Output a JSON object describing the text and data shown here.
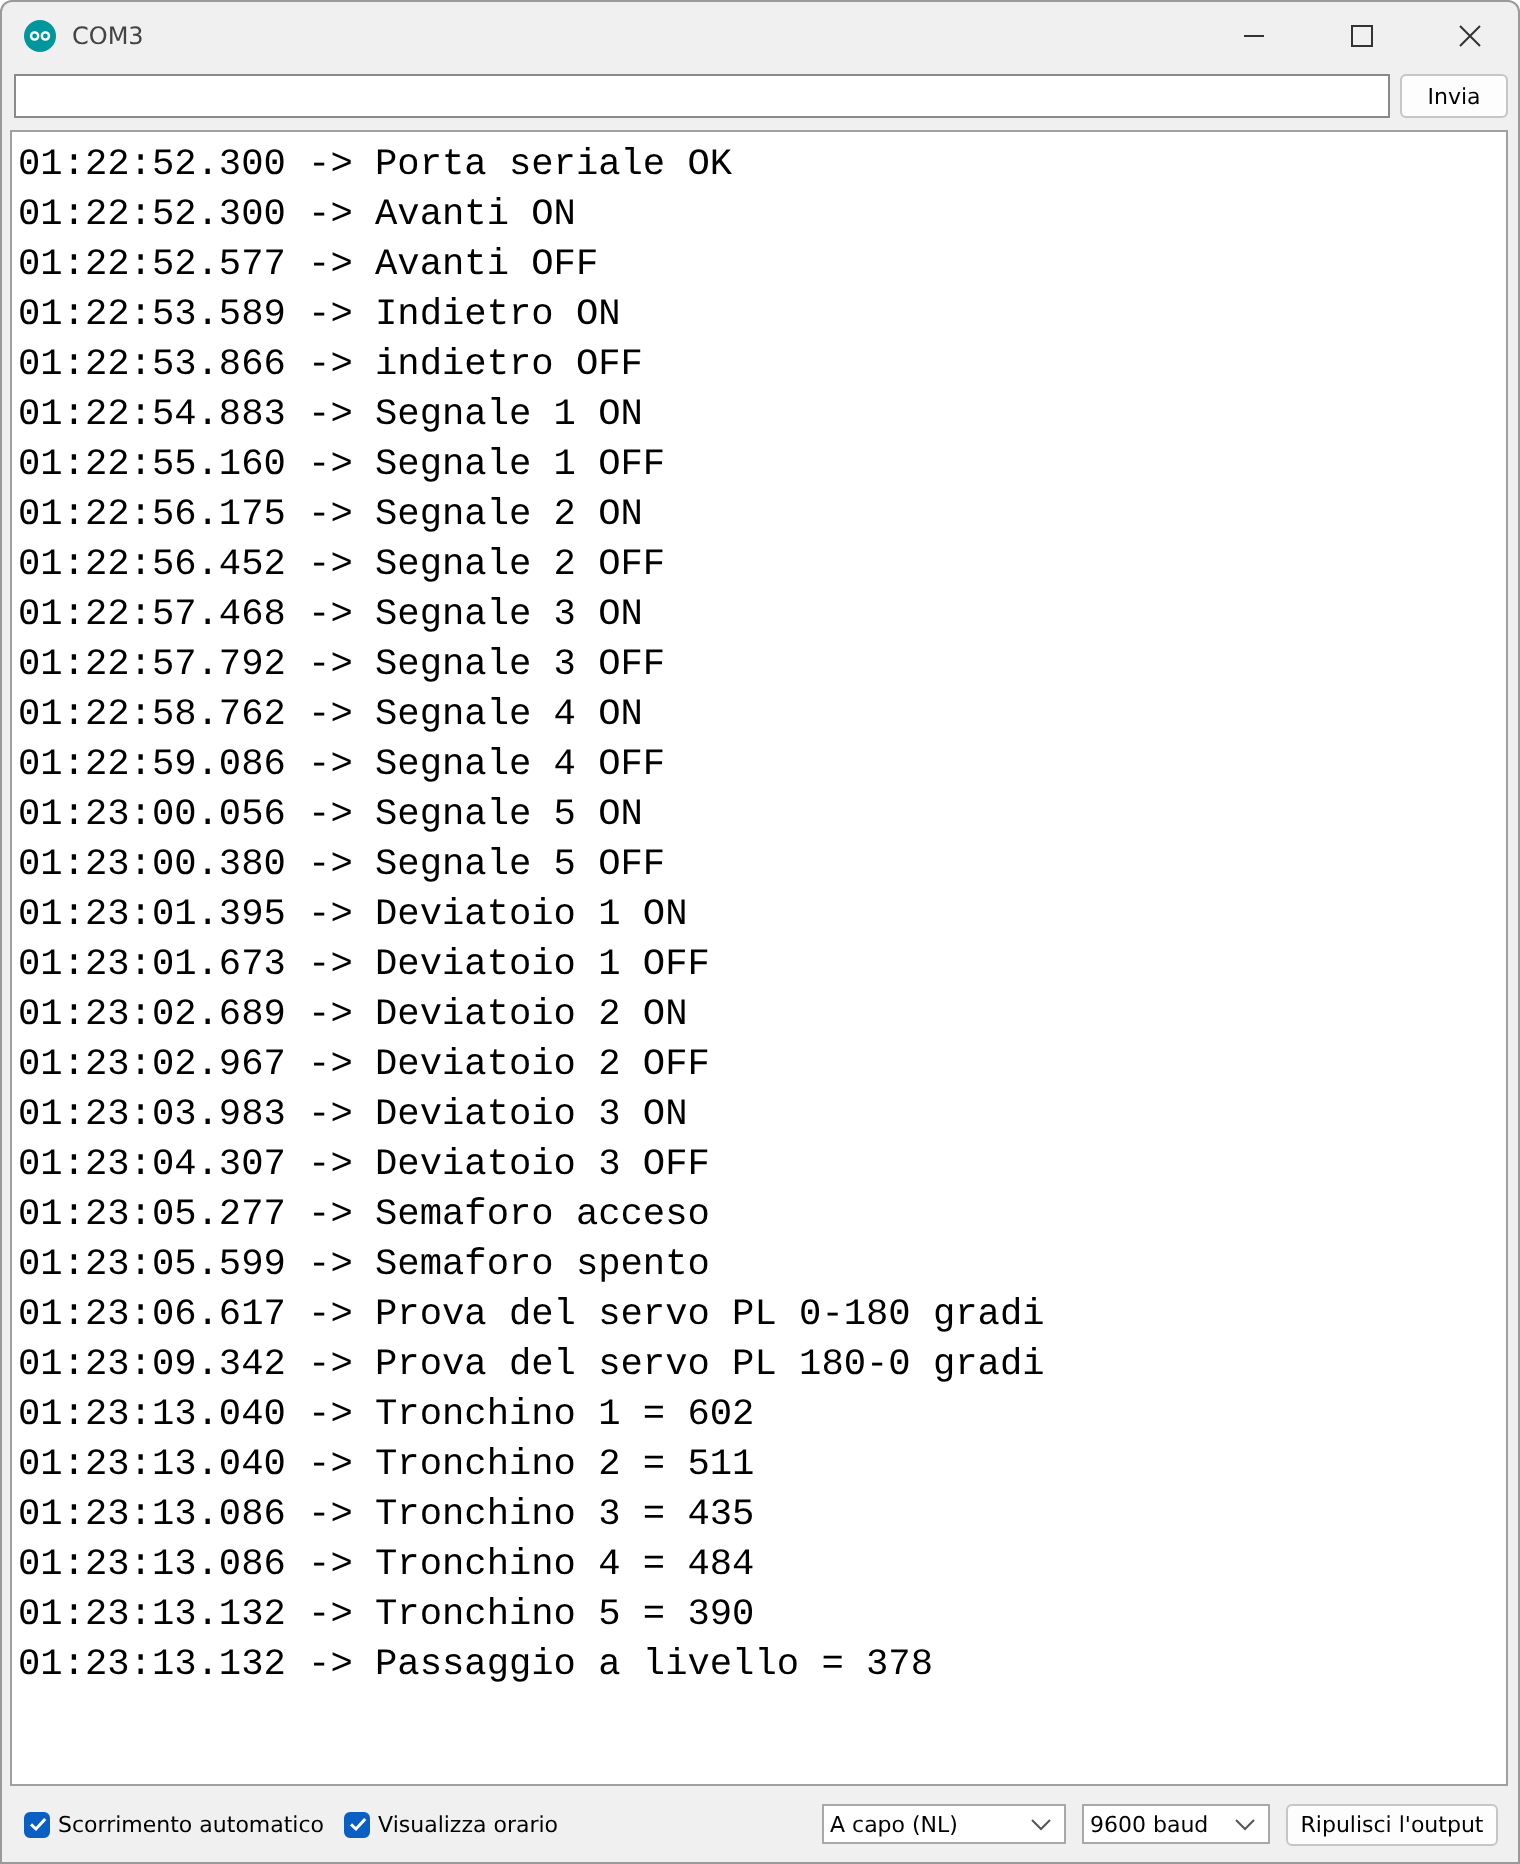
{
  "window": {
    "title": "COM3"
  },
  "send_button": "Invia",
  "log": [
    "01:22:52.300 -> Porta seriale OK",
    "01:22:52.300 -> Avanti ON",
    "01:22:52.577 -> Avanti OFF",
    "01:22:53.589 -> Indietro ON",
    "01:22:53.866 -> indietro OFF",
    "01:22:54.883 -> Segnale 1 ON",
    "01:22:55.160 -> Segnale 1 OFF",
    "01:22:56.175 -> Segnale 2 ON",
    "01:22:56.452 -> Segnale 2 OFF",
    "01:22:57.468 -> Segnale 3 ON",
    "01:22:57.792 -> Segnale 3 OFF",
    "01:22:58.762 -> Segnale 4 ON",
    "01:22:59.086 -> Segnale 4 OFF",
    "01:23:00.056 -> Segnale 5 ON",
    "01:23:00.380 -> Segnale 5 OFF",
    "01:23:01.395 -> Deviatoio 1 ON",
    "01:23:01.673 -> Deviatoio 1 OFF",
    "01:23:02.689 -> Deviatoio 2 ON",
    "01:23:02.967 -> Deviatoio 2 OFF",
    "01:23:03.983 -> Deviatoio 3 ON",
    "01:23:04.307 -> Deviatoio 3 OFF",
    "01:23:05.277 -> Semaforo acceso",
    "01:23:05.599 -> Semaforo spento",
    "01:23:06.617 -> Prova del servo PL 0-180 gradi",
    "01:23:09.342 -> Prova del servo PL 180-0 gradi",
    "01:23:13.040 -> Tronchino 1 = 602",
    "01:23:13.040 -> Tronchino 2 = 511",
    "01:23:13.086 -> Tronchino 3 = 435",
    "01:23:13.086 -> Tronchino 4 = 484",
    "01:23:13.132 -> Tronchino 5 = 390",
    "01:23:13.132 -> Passaggio a livello = 378"
  ],
  "options": [
    {
      "label": "Scorrimento automatico",
      "checked": true
    },
    {
      "label": "Visualizza orario",
      "checked": true
    }
  ],
  "line_ending": "A capo (NL)",
  "baud_rate": "9600 baud",
  "clear_button": "Ripulisci l'output"
}
